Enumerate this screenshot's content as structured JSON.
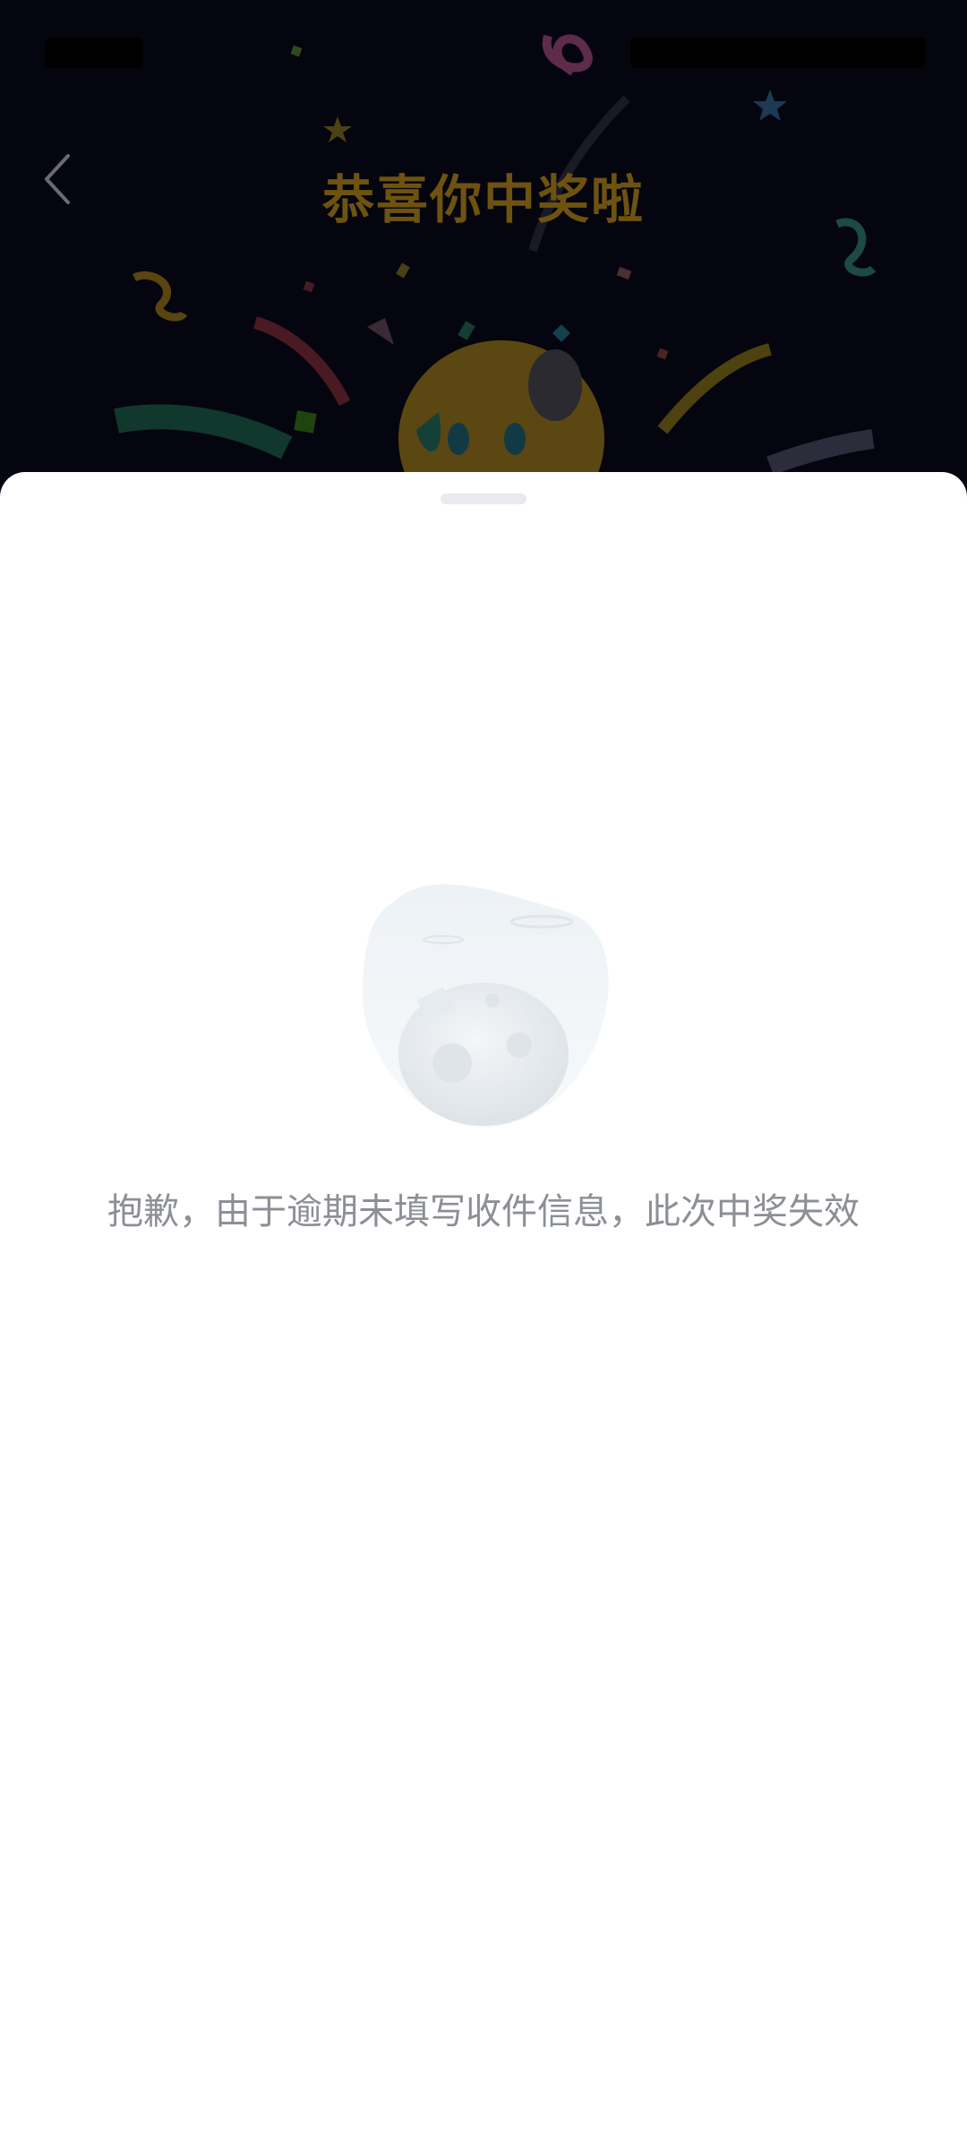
{
  "header": {
    "title": "恭喜你中奖啦"
  },
  "sheet": {
    "message": "抱歉，由于逾期未填写收件信息，此次中奖失效"
  },
  "icons": {
    "back": "chevron-left-icon",
    "empty": "empty-planet-illustration"
  },
  "colors": {
    "header_background": "#05050f",
    "title": "#6e5310",
    "message": "#8c8f96",
    "sheet_background": "#ffffff"
  }
}
